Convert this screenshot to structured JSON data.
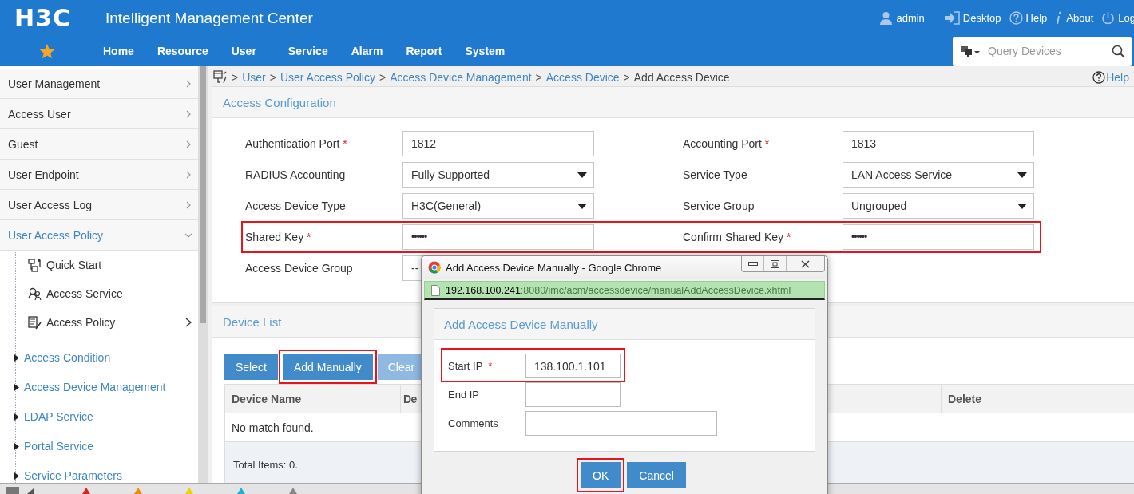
{
  "header": {
    "logo": "H3C",
    "title": "Intelligent Management Center",
    "user_links": [
      {
        "label": "admin"
      },
      {
        "label": "Desktop"
      },
      {
        "label": "Help"
      },
      {
        "label": "About"
      },
      {
        "label": "Log"
      }
    ],
    "nav": [
      {
        "label": "Home"
      },
      {
        "label": "Resource"
      },
      {
        "label": "User"
      },
      {
        "label": "Service"
      },
      {
        "label": "Alarm"
      },
      {
        "label": "Report"
      },
      {
        "label": "System"
      }
    ],
    "search": {
      "placeholder": "Query Devices"
    }
  },
  "sidebar": {
    "items": [
      {
        "label": "User Management",
        "expanded": false
      },
      {
        "label": "Access User",
        "expanded": false
      },
      {
        "label": "Guest",
        "expanded": false
      },
      {
        "label": "User Endpoint",
        "expanded": false
      },
      {
        "label": "User Access Log",
        "expanded": false
      },
      {
        "label": "User Access Policy",
        "expanded": true,
        "children": [
          {
            "label": "Quick Start",
            "kind": "page",
            "has_submenu": false
          },
          {
            "label": "Access Service",
            "kind": "page",
            "has_submenu": false
          },
          {
            "label": "Access Policy",
            "kind": "page",
            "has_submenu": true
          },
          {
            "label": "Access Condition",
            "kind": "folder"
          },
          {
            "label": "Access Device Management",
            "kind": "folder"
          },
          {
            "label": "LDAP Service",
            "kind": "folder"
          },
          {
            "label": "Portal Service",
            "kind": "folder"
          },
          {
            "label": "Service Parameters",
            "kind": "folder"
          }
        ]
      }
    ]
  },
  "breadcrumb": {
    "separator": ">",
    "items": [
      "User",
      "User Access Policy",
      "Access Device Management",
      "Access Device",
      "Add Access Device"
    ],
    "help": "Help"
  },
  "access_configuration": {
    "title": "Access Configuration",
    "rows": [
      {
        "highlighted": false,
        "fields": [
          {
            "label": "Authentication Port",
            "required_mark": "*",
            "kind": "text",
            "value": "1812"
          },
          {
            "label": "Accounting Port",
            "required_mark": "*",
            "kind": "text",
            "value": "1813"
          }
        ]
      },
      {
        "highlighted": false,
        "fields": [
          {
            "label": "RADIUS Accounting",
            "kind": "select",
            "value": "Fully Supported"
          },
          {
            "label": "Service Type",
            "kind": "select",
            "value": "LAN Access Service"
          }
        ]
      },
      {
        "highlighted": false,
        "fields": [
          {
            "label": "Access Device Type",
            "kind": "select",
            "value": "H3C(General)"
          },
          {
            "label": "Service Group",
            "kind": "select",
            "value": "Ungrouped"
          }
        ]
      },
      {
        "highlighted": true,
        "fields": [
          {
            "label": "Shared Key",
            "required_mark": "*",
            "kind": "password",
            "value": "••••••"
          },
          {
            "label": "Confirm Shared Key",
            "required_mark": "*",
            "kind": "password",
            "value": "••••••"
          }
        ]
      },
      {
        "highlighted": false,
        "fields": [
          {
            "label": "Access Device Group",
            "kind": "text",
            "value": "--"
          }
        ]
      }
    ]
  },
  "device_list": {
    "title": "Device List",
    "buttons": [
      {
        "label": "Select",
        "disabled": false,
        "highlighted": false
      },
      {
        "label": "Add Manually",
        "disabled": false,
        "highlighted": true
      },
      {
        "label": "Clear",
        "disabled": true,
        "highlighted": false
      }
    ],
    "table": {
      "columns": [
        "Device Name",
        "De",
        "Delete"
      ],
      "empty_message": "No match found.",
      "footer": "Total Items: 0."
    }
  },
  "dialog": {
    "window_title": "Add Access Device Manually - Google Chrome",
    "url_host": "192.168.100.241",
    "url_path": ":8080/imc/acm/accessdevice/manualAddAccessDevice.xhtml",
    "heading": "Add Access Device Manually",
    "fields": [
      {
        "label": "Start IP",
        "required_mark": "*",
        "kind": "short",
        "value": "138.100.1.101",
        "highlighted": true
      },
      {
        "label": "End IP",
        "kind": "short",
        "highlighted": false
      },
      {
        "label": "Comments",
        "kind": "long",
        "highlighted": false
      }
    ],
    "buttons": [
      {
        "label": "OK",
        "highlighted": true
      },
      {
        "label": "Cancel",
        "highlighted": false
      }
    ]
  }
}
